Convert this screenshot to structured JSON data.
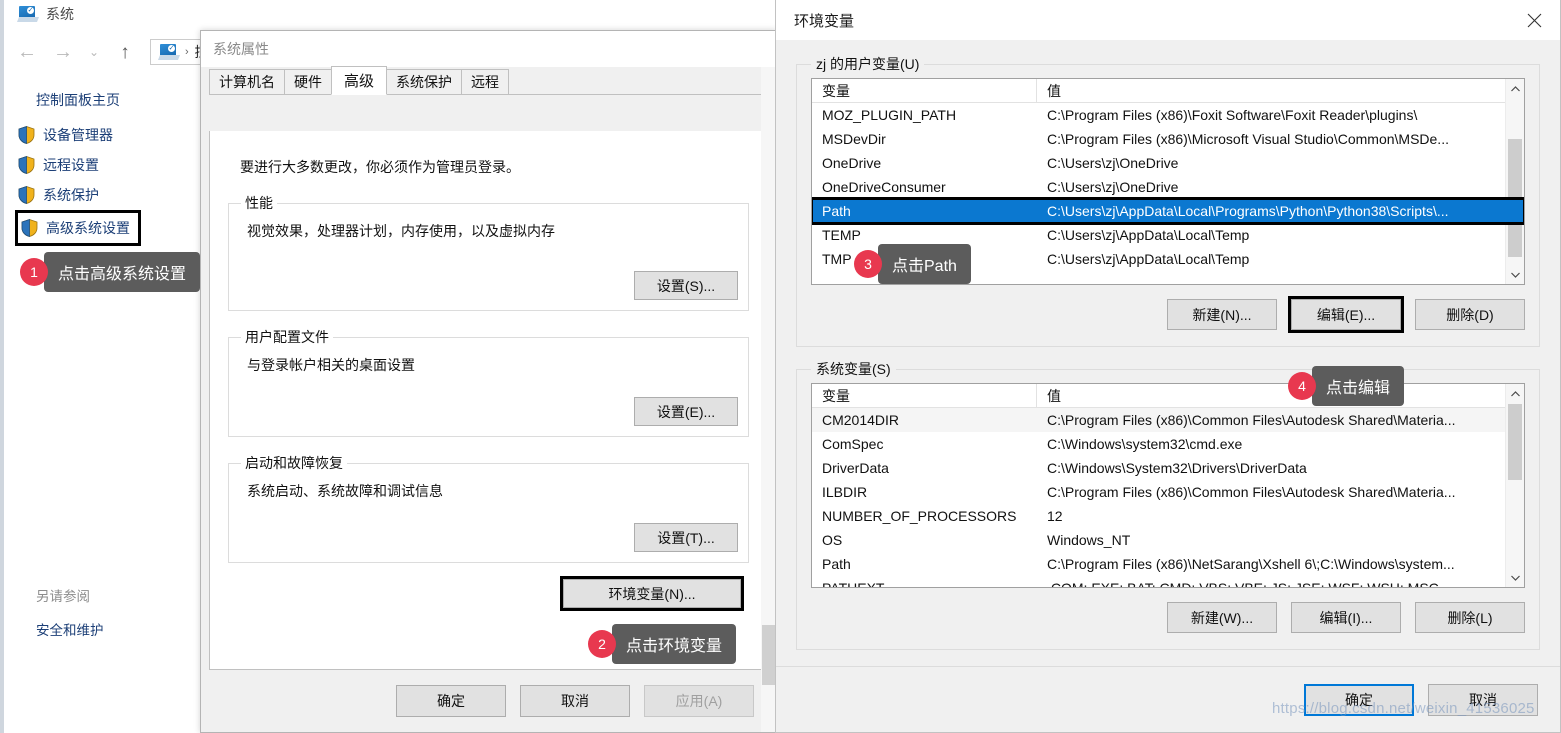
{
  "explorer": {
    "window_title": "系统",
    "nav": {
      "back": "←",
      "forward": "→",
      "recent": "⌄",
      "up": "↑"
    },
    "address": {
      "crumb_sep": "›",
      "crumb_text": "控"
    },
    "sidebar": {
      "home_label": "控制面板主页",
      "items": [
        {
          "label": "设备管理器",
          "icon": "shield-icon",
          "highlighted": false
        },
        {
          "label": "远程设置",
          "icon": "shield-icon",
          "highlighted": false
        },
        {
          "label": "系统保护",
          "icon": "shield-icon",
          "highlighted": false
        },
        {
          "label": "高级系统设置",
          "icon": "shield-icon",
          "highlighted": true
        }
      ]
    },
    "see_also": {
      "title": "另请参阅",
      "link": "安全和维护"
    }
  },
  "system_properties": {
    "title": "系统属性",
    "tabs": [
      {
        "label": "计算机名",
        "active": false
      },
      {
        "label": "硬件",
        "active": false
      },
      {
        "label": "高级",
        "active": true
      },
      {
        "label": "系统保护",
        "active": false
      },
      {
        "label": "远程",
        "active": false
      }
    ],
    "note": "要进行大多数更改，你必须作为管理员登录。",
    "groups": [
      {
        "legend": "性能",
        "desc": "视觉效果，处理器计划，内存使用，以及虚拟内存",
        "button": "设置(S)..."
      },
      {
        "legend": "用户配置文件",
        "desc": "与登录帐户相关的桌面设置",
        "button": "设置(E)..."
      },
      {
        "legend": "启动和故障恢复",
        "desc": "系统启动、系统故障和调试信息",
        "button": "设置(T)..."
      }
    ],
    "env_button": "环境变量(N)...",
    "footer": {
      "ok": "确定",
      "cancel": "取消",
      "apply": "应用(A)"
    }
  },
  "env_dialog": {
    "title": "环境变量",
    "close_icon": "close-icon",
    "user_section": {
      "legend": "zj 的用户变量(U)",
      "columns": [
        "变量",
        "值"
      ],
      "rows": [
        {
          "name": "MOZ_PLUGIN_PATH",
          "value": "C:\\Program Files (x86)\\Foxit Software\\Foxit Reader\\plugins\\",
          "selected": false
        },
        {
          "name": "MSDevDir",
          "value": "C:\\Program Files (x86)\\Microsoft Visual Studio\\Common\\MSDe...",
          "selected": false
        },
        {
          "name": "OneDrive",
          "value": "C:\\Users\\zj\\OneDrive",
          "selected": false
        },
        {
          "name": "OneDriveConsumer",
          "value": "C:\\Users\\zj\\OneDrive",
          "selected": false
        },
        {
          "name": "Path",
          "value": "C:\\Users\\zj\\AppData\\Local\\Programs\\Python\\Python38\\Scripts\\...",
          "selected": true
        },
        {
          "name": "TEMP",
          "value": "C:\\Users\\zj\\AppData\\Local\\Temp",
          "selected": false
        },
        {
          "name": "TMP",
          "value": "C:\\Users\\zj\\AppData\\Local\\Temp",
          "selected": false
        }
      ],
      "buttons": {
        "new": "新建(N)...",
        "edit": "编辑(E)...",
        "delete": "删除(D)"
      }
    },
    "system_section": {
      "legend": "系统变量(S)",
      "columns": [
        "变量",
        "值"
      ],
      "rows": [
        {
          "name": "CM2014DIR",
          "value": "C:\\Program Files (x86)\\Common Files\\Autodesk Shared\\Materia..."
        },
        {
          "name": "ComSpec",
          "value": "C:\\Windows\\system32\\cmd.exe"
        },
        {
          "name": "DriverData",
          "value": "C:\\Windows\\System32\\Drivers\\DriverData"
        },
        {
          "name": "ILBDIR",
          "value": "C:\\Program Files (x86)\\Common Files\\Autodesk Shared\\Materia..."
        },
        {
          "name": "NUMBER_OF_PROCESSORS",
          "value": "12"
        },
        {
          "name": "OS",
          "value": "Windows_NT"
        },
        {
          "name": "Path",
          "value": "C:\\Program Files (x86)\\NetSarang\\Xshell 6\\;C:\\Windows\\system..."
        },
        {
          "name": "PATHEXT",
          "value": ".COM;.EXE;.BAT;.CMD;.VBS;.VBE;.JS;.JSE;.WSF;.WSH;.MSC"
        }
      ],
      "buttons": {
        "new": "新建(W)...",
        "edit": "编辑(I)...",
        "delete": "删除(L)"
      }
    },
    "footer": {
      "ok": "确定",
      "cancel": "取消"
    }
  },
  "callouts": [
    {
      "number": "1",
      "text": "点击高级系统设置"
    },
    {
      "number": "2",
      "text": "点击环境变量"
    },
    {
      "number": "3",
      "text": "点击Path"
    },
    {
      "number": "4",
      "text": "点击编辑"
    }
  ],
  "watermark": "https://blog.csdn.net/weixin_41536025",
  "colors": {
    "selection_blue": "#0b78d0",
    "badge_red": "#e8384f",
    "bubble_gray": "#5c5c5c",
    "link_blue": "#1c3f77",
    "dialog_bg": "#f0f0f0"
  }
}
